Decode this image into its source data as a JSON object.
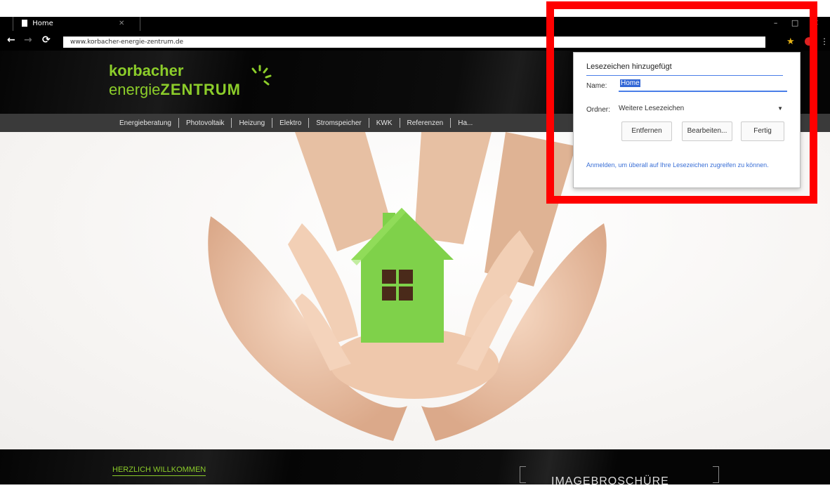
{
  "browser": {
    "tab_title": "Home",
    "url": "www.korbacher-energie-zentrum.de",
    "window_controls": "– □ ✕"
  },
  "site": {
    "logo_line1": "korbacher",
    "logo_line2_prefix": "energie",
    "logo_line2_bold": "ZENTRUM",
    "brand_color": "#8ccd2a",
    "nav_items": [
      "Energieberatung",
      "Photovoltaik",
      "Heizung",
      "Elektro",
      "Stromspeicher",
      "KWK",
      "Referenzen",
      "Ha..."
    ],
    "welcome": "HERZLICH WILLKOMMEN",
    "brochure": "IMAGEBROSCHÜRE"
  },
  "dialog": {
    "title": "Lesezeichen hinzugefügt",
    "name_label": "Name:",
    "name_value": "Home",
    "folder_label": "Ordner:",
    "folder_value": "Weitere Lesezeichen",
    "btn_delete": "Entfernen",
    "btn_edit": "Bearbeiten...",
    "btn_done": "Fertig",
    "sync_link": "Anmelden, um überall auf Ihre Lesezeichen zugreifen zu können."
  }
}
